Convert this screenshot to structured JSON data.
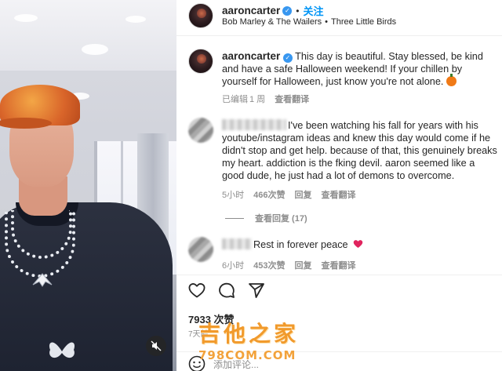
{
  "header": {
    "username": "aaroncarter",
    "separator": "•",
    "follow_label": "关注",
    "music_artist": "Bob Marley & The Wailers",
    "music_separator": "•",
    "music_track": "Three Little Birds"
  },
  "caption": {
    "username": "aaroncarter",
    "text": "This day is beautiful. Stay blessed, be kind and have a safe Halloween weekend! If your chillen by yourself for Halloween, just know you're not alone.",
    "edited": "已编辑",
    "time": "1 周",
    "translate": "查看翻译"
  },
  "comments": [
    {
      "text": "I've been watching his fall for years with his youtube/instagram ideas and knew this day would come if he didn't stop and get help. because of that, this genuinely breaks my heart. addiction is the fking devil. aaron seemed like a good dude, he just had a lot of demons to overcome.",
      "time": "5小时",
      "likes": "466次赞",
      "reply": "回复",
      "translate": "查看翻译"
    },
    {
      "text": "Rest in forever peace",
      "time": "6小时",
      "likes": "453次赞",
      "reply": "回复",
      "translate": "查看翻译"
    }
  ],
  "replies_label": "查看回复 (17)",
  "post": {
    "likes": "7933 次赞",
    "time": "7天前",
    "add_comment_placeholder": "添加评论..."
  },
  "watermark": {
    "main": "吉他之家",
    "sub": "798COM.COM"
  },
  "icons": {
    "verified": "verified-badge-icon",
    "like": "heart-icon",
    "comment": "comment-icon",
    "share": "send-icon",
    "mute": "speaker-muted-icon",
    "emoji": "pumpkin-emoji",
    "emoji_picker": "smiley-icon"
  },
  "colors": {
    "link_blue": "#0095f6",
    "verified_blue": "#3897f0",
    "heart_red": "#ed4956",
    "muted_text": "#8e8e8e",
    "watermark_orange": "#f19a2c"
  }
}
